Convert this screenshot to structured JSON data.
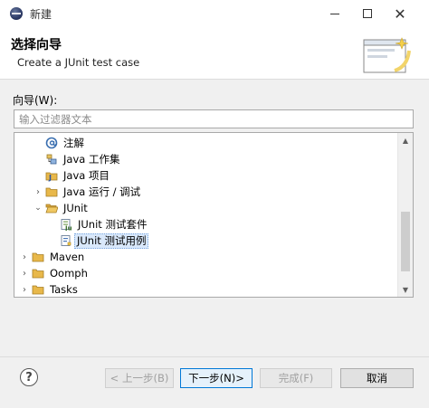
{
  "window": {
    "title": "新建"
  },
  "header": {
    "title": "选择向导",
    "description": "Create a JUnit test case"
  },
  "filter": {
    "label": "向导(W):",
    "placeholder": "输入过滤器文本"
  },
  "tree": {
    "items": [
      {
        "label": "注解",
        "icon": "annotation-icon",
        "indent": 1,
        "twisty": "none"
      },
      {
        "label": "Java 工作集",
        "icon": "working-set-icon",
        "indent": 1,
        "twisty": "none"
      },
      {
        "label": "Java 项目",
        "icon": "java-project-icon",
        "indent": 1,
        "twisty": "none"
      },
      {
        "label": "Java 运行 / 调试",
        "icon": "folder-icon",
        "indent": 1,
        "twisty": "collapsed"
      },
      {
        "label": "JUnit",
        "icon": "folder-open-icon",
        "indent": 1,
        "twisty": "expanded"
      },
      {
        "label": "JUnit 测试套件",
        "icon": "junit-suite-icon",
        "indent": 2,
        "twisty": "none"
      },
      {
        "label": "JUnit 测试用例",
        "icon": "junit-testcase-icon",
        "indent": 2,
        "twisty": "none",
        "selected": true
      },
      {
        "label": "Maven",
        "icon": "folder-icon",
        "indent": 0,
        "twisty": "collapsed"
      },
      {
        "label": "Oomph",
        "icon": "folder-icon",
        "indent": 0,
        "twisty": "collapsed"
      },
      {
        "label": "Tasks",
        "icon": "folder-icon",
        "indent": 0,
        "twisty": "collapsed"
      }
    ]
  },
  "buttons": {
    "back": "< 上一步(B)",
    "next": "下一步(N)>",
    "finish": "完成(F)",
    "cancel": "取消"
  },
  "colors": {
    "selection": "#d9e8fb",
    "default_button_border": "#0078d7",
    "folder": "#e8b84a"
  }
}
